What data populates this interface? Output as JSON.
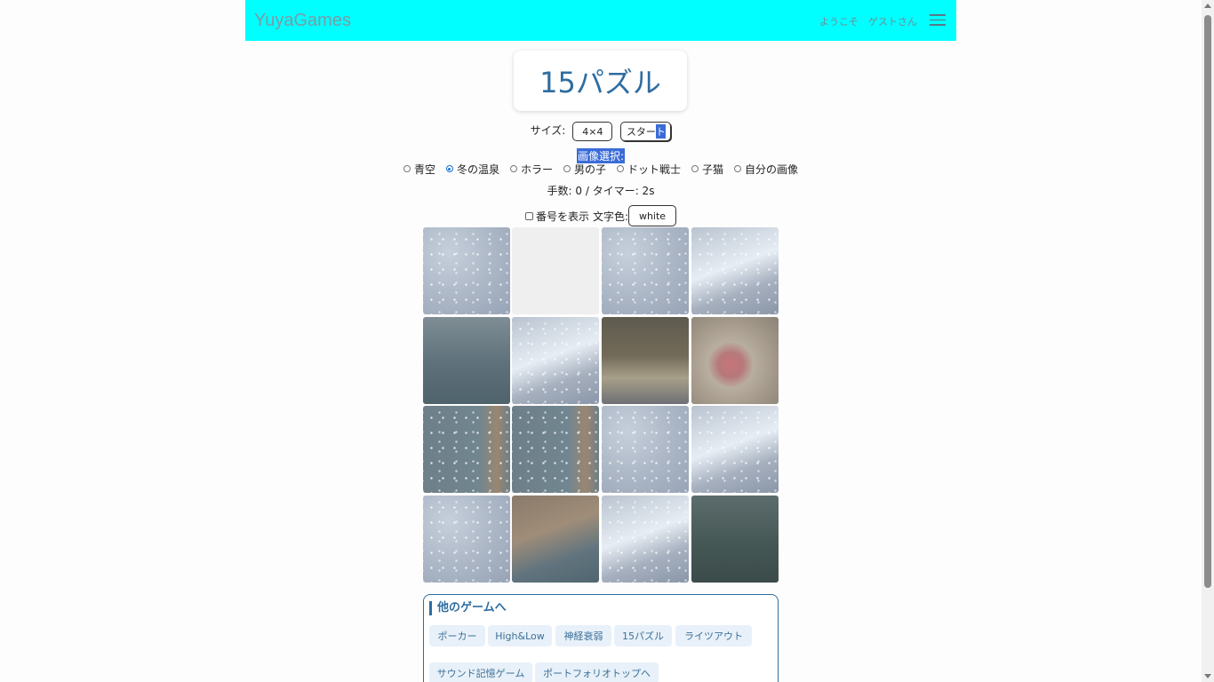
{
  "navbar": {
    "brand": "YuyaGames",
    "welcome": "ようこそ　ゲストさん",
    "menu_icon": "hamburger-icon"
  },
  "title": "15パズル",
  "size": {
    "label": "サイズ:",
    "value": "4×4",
    "start_label_part1": "スター",
    "start_label_part2": "ト"
  },
  "image_select": {
    "label": "画像選択:",
    "options": [
      "青空",
      "冬の温泉",
      "ホラー",
      "男の子",
      "ドット戦士",
      "子猫",
      "自分の画像"
    ],
    "selected": "冬の温泉"
  },
  "status": "手数: 0 / タイマー: 2s",
  "display": {
    "show_numbers_label": "番号を表示",
    "checked": false,
    "text_color_label": "文字色:",
    "text_color_value": "white"
  },
  "other_games": {
    "title": "他のゲームへ",
    "links": [
      "ポーカー",
      "High&Low",
      "神経衰弱",
      "15パズル",
      "ライツアウト",
      "サウンド記憶ゲーム",
      "ポートフォリオトップへ"
    ]
  },
  "colors": {
    "navbar": "#00ffff",
    "accent": "#2e6da0"
  }
}
